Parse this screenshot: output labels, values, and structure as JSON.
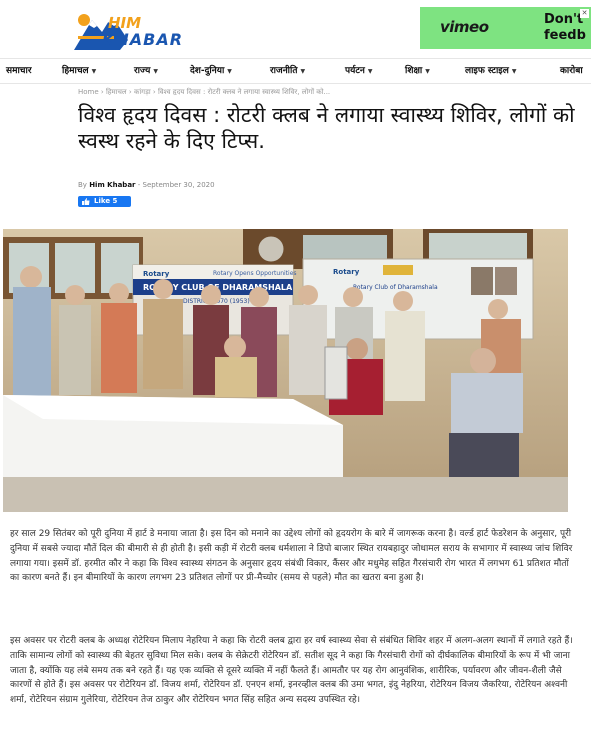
{
  "site": {
    "logo_top": "HIM",
    "logo_bottom": "KHABAR"
  },
  "ad": {
    "brand": "vimeo",
    "line1": "Don't",
    "line2": "feedb",
    "close": "✕",
    "colors": {
      "background": "#7ee381"
    }
  },
  "nav": {
    "items": [
      {
        "label": "समाचार",
        "dropdown": false
      },
      {
        "label": "हिमाचल",
        "dropdown": true
      },
      {
        "label": "राज्य",
        "dropdown": true
      },
      {
        "label": "देश-दुनिया",
        "dropdown": true
      },
      {
        "label": "राजनीति",
        "dropdown": true
      },
      {
        "label": "पर्यटन",
        "dropdown": true
      },
      {
        "label": "शिक्षा",
        "dropdown": true
      },
      {
        "label": "लाइफ स्टाइल",
        "dropdown": true
      },
      {
        "label": "कारोबा",
        "dropdown": false
      }
    ]
  },
  "breadcrumb": {
    "items": [
      "Home",
      "हिमाचल",
      "कांगड़ा",
      "विश्व हृदय दिवस : रोटरी क्लब ने लगाया स्वास्थ्य शिविर, लोगों को..."
    ],
    "separator": "›"
  },
  "article": {
    "title": "विश्व हृदय दिवस : रोटरी क्लब ने लगाया स्वास्थ्य शिविर, लोगों को स्वस्थ रहने के दिए टिप्स.",
    "by": "By",
    "author": "Him Khabar",
    "dash": "-",
    "date": "September 30, 2020",
    "like_label": "Like 5",
    "photo": {
      "banner_rotary": "Rotary",
      "banner_club": "ROTARY CLUB OF DHARAMSHALA",
      "banner_district": "DISTRICT 3070 (1953)",
      "banner_opens": "Rotary Opens Opportunities",
      "banner_right_club": "Rotary Club of Dharamshala"
    },
    "paragraphs": [
      "हर साल 29 सितंबर को पूरी दुनिया में हार्ट डे मनाया जाता है। इस दिन को मनाने का उद्देश्य लोगों को हृदयरोग के बारे में जागरूक करना है। वर्ल्ड हार्ट फेडरेशन के अनुसार, पूरी दुनिया में सबसे ज्यादा मौतें दिल की बीमारी से ही होती है। इसी कड़ी में रोटरी क्लब धर्मशाला ने डिपो बाजार स्थित रायबहादुर जोधामल सराय के सभागार में स्वास्थ्य जांच शिविर लगाया गया। इसमें डॉ. हरमीत कौर ने कहा कि विश्व स्वास्थ्य संगठन के अनुसार हृदय संबंधी विकार, कैंसर और मधुमेह सहित गैरसंचारी रोग भारत में लगभग 61 प्रतिशत मौतों का कारण बनते हैं। इन बीमारियों के कारण लगभग 23 प्रतिशत लोगों पर प्री-मैच्योर (समय से पहले) मौत का खतरा बना हुआ है।",
      "इस अवसर पर रोटरी क्लब के अध्यक्ष रोटेरियन मिलाप नेहरिया ने कहा कि रोटरी क्लब द्वारा हर वर्ष स्वास्थ्य सेवा से संबंधित शिविर शहर में अलग-अलग स्थानों में लगाते रहते हैं। ताकि सामान्य लोगों को स्वास्थ्य की बेहतर सुविधा मिल सके। क्लब के सेक्रेटरी रोटेरियन डॉ. सतीश सूद ने कहा कि गैरसंचारी रोगों को दीर्घकालिक बीमारियों के रूप में भी जाना जाता है, क्योंकि यह लंबे समय तक बने रहते हैं। यह एक व्यक्ति से दूसरे व्यक्ति में नहीं फैलते हैं। आमतौर पर यह रोग आनुवंशिक, शारीरिक, पर्यावरण और जीवन-शैली जैसे कारणों से होते हैं। इस अवसर पर रोटेरियन डॉ. विजय शर्मा, रोटेरियन डॉ. एनएन शर्मा, इनरव्हील क्लब की उमा भगत, इंदु नेहरिया, रोटेरियन विजय जैकरिया, रोटेरियन अश्वनी शर्मा, रोटेरियन संग्राम गुलेरिया, रोटेरियन तेज ठाकुर और रोटेरियन भगत सिंह सहित अन्य सदस्य उपस्थित रहे।"
    ]
  },
  "colors": {
    "accent": "#1877f2",
    "logo_blue": "#1a56b0",
    "logo_orange": "#f2a11c"
  }
}
